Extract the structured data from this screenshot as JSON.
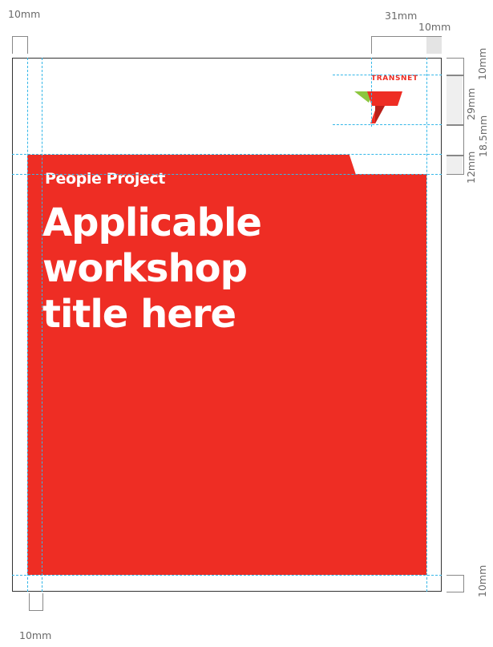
{
  "document": {
    "subtitle": "People Project",
    "title_lines": [
      "Applicable",
      "workshop",
      "title here"
    ]
  },
  "logo": {
    "wordmark": "TRANSNET",
    "colors": {
      "red": "#ee2d24",
      "green": "#8cc63f"
    }
  },
  "dimensions": {
    "top_left": "10mm",
    "top_right_outer": "31mm",
    "top_right_inner": "10mm",
    "right_top": "10mm",
    "right_logo_height": "29mm",
    "right_clearance": "18.5mm",
    "right_band": "12mm",
    "right_bottom": "10mm",
    "bottom_left": "10mm"
  },
  "colors": {
    "red_panel": "#ee2d24",
    "guide": "#35b7e8"
  }
}
